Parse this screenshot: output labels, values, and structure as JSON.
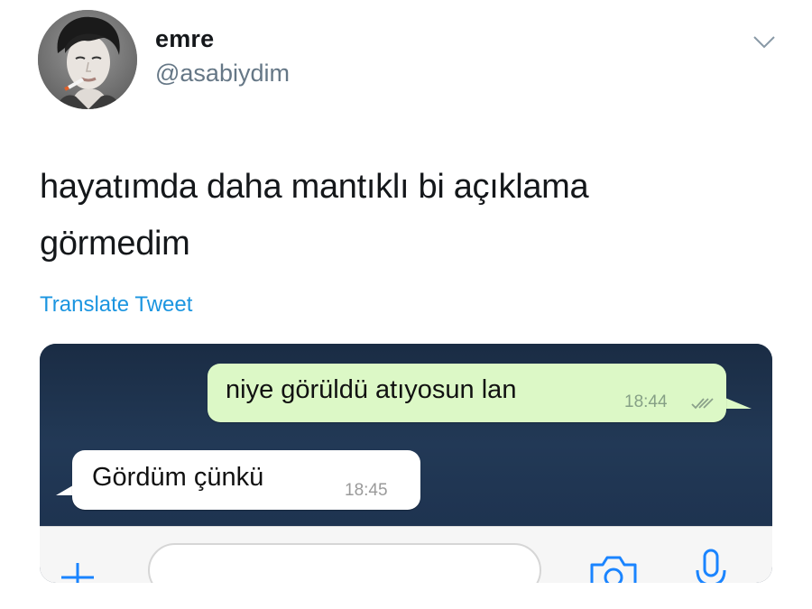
{
  "author": {
    "display_name": "emre",
    "handle": "@asabiydim",
    "avatar_icon": "avatar-photo"
  },
  "tweet": {
    "text_line1": "hayatımda daha mantıklı bi açıklama",
    "text_line2": "görmedim",
    "translate_label": "Translate Tweet",
    "menu_icon": "chevron-down-icon"
  },
  "chat": {
    "messages": [
      {
        "direction": "outgoing",
        "text": "niye görüldü atıyosun lan",
        "time": "18:44",
        "status_icon": "double-check-icon"
      },
      {
        "direction": "incoming",
        "text": "Gördüm çünkü",
        "time": "18:45"
      }
    ],
    "input": {
      "value": "",
      "placeholder": ""
    },
    "icons": {
      "add": "plus-icon",
      "camera": "camera-icon",
      "mic": "microphone-icon"
    },
    "colors": {
      "outgoing_bubble": "#dcf8c6",
      "incoming_bubble": "#ffffff",
      "accent": "#1a84ff",
      "wallpaper": "#1d3049"
    }
  },
  "colors": {
    "link": "#1b95e0",
    "text": "#14171a",
    "secondary": "#657786"
  }
}
